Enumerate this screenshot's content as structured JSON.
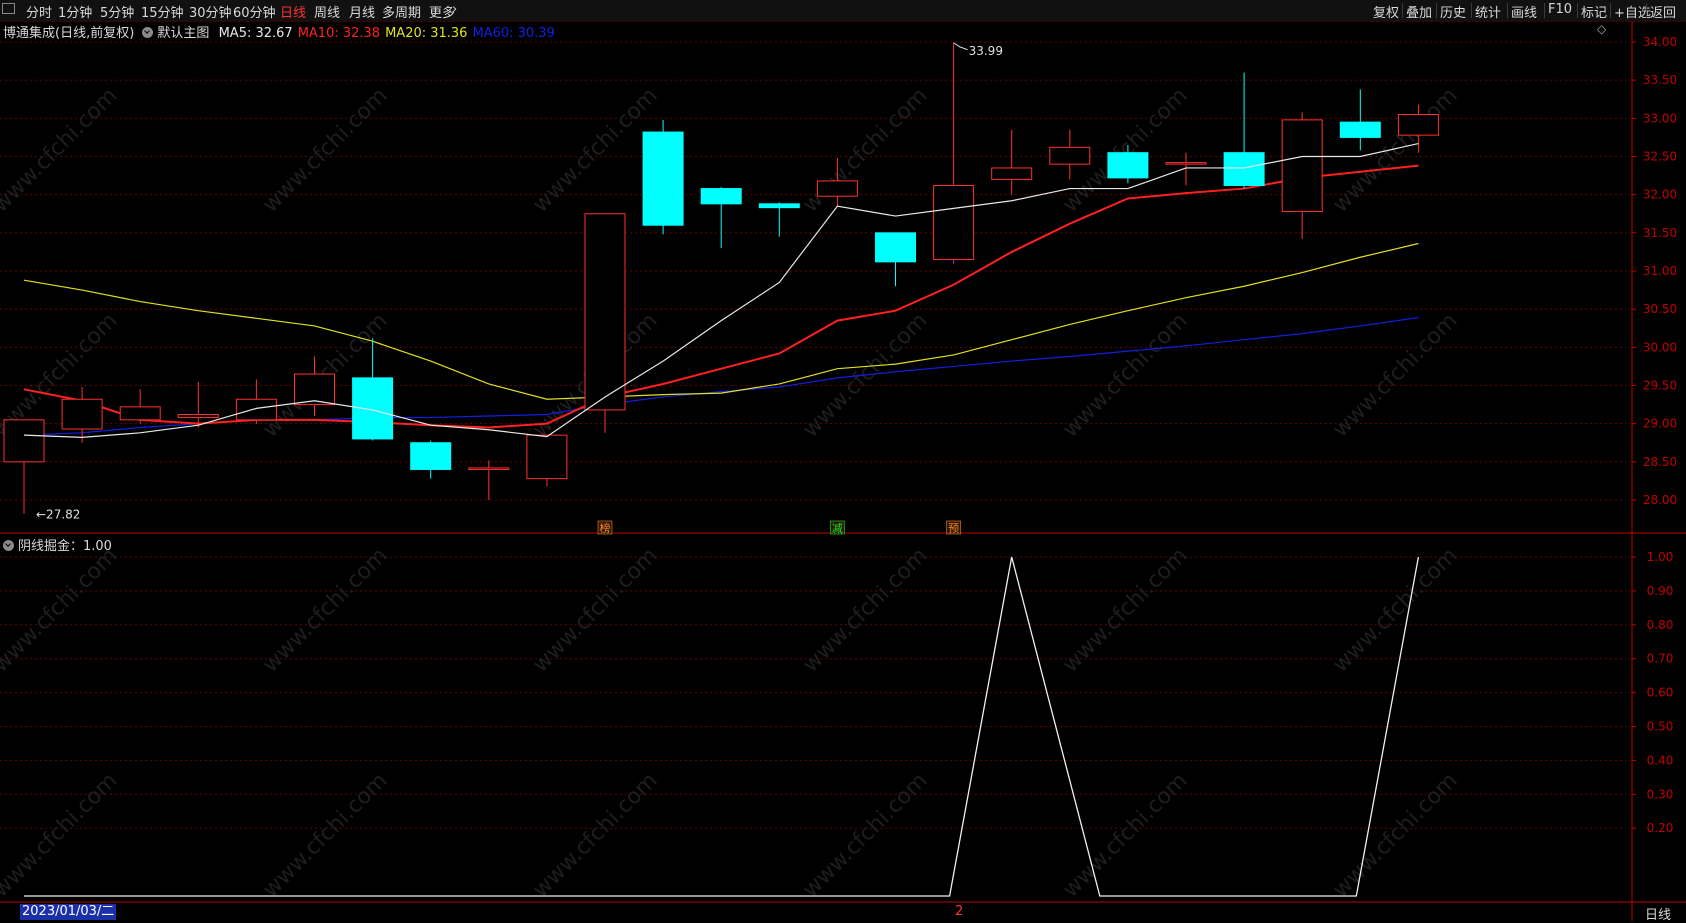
{
  "toolbar": {
    "corner_icon": "window-icon",
    "tabs": [
      "分时",
      "1分钟",
      "5分钟",
      "15分钟",
      "30分钟",
      "60分钟",
      "日线",
      "周线",
      "月线",
      "多周期",
      "更多"
    ],
    "active_tab": "日线",
    "more_chevron": "›",
    "right_buttons": [
      "复权",
      "叠加",
      "历史",
      "统计",
      "画线",
      "F10",
      "标记",
      "+自选",
      "返回"
    ]
  },
  "main_panel": {
    "stock_title": "博通集成(日线,前复权)",
    "template": "默认主图",
    "ma_labels": [
      {
        "text": "MA5: 32.67",
        "color": "#e8e8e8"
      },
      {
        "text": "MA10: 32.38",
        "color": "#ff2020"
      },
      {
        "text": "MA20: 31.36",
        "color": "#e0e020"
      },
      {
        "text": "MA60: 30.39",
        "color": "#1020e0"
      }
    ],
    "expand_icon": "diamond-icon",
    "high_label": "33.99",
    "low_label": "27.82",
    "markers": [
      {
        "text": "榜",
        "color": "#ff8020"
      },
      {
        "text": "减",
        "color": "#20e020"
      },
      {
        "text": "预",
        "color": "#ff8020"
      }
    ]
  },
  "indicator_panel": {
    "title": "阴线掘金：1.00"
  },
  "bottom_bar": {
    "date": "2023/01/03/二",
    "center_mark": "2",
    "period_label": "日线"
  },
  "watermark": "www.cfchi.com",
  "colors": {
    "up": "#ff3030",
    "down": "#00ffff",
    "ma5": "#e8e8e8",
    "ma10": "#ff2020",
    "ma20": "#e0e020",
    "ma60": "#1020e0",
    "axis": "#c00000"
  },
  "chart_data": {
    "type": "candlestick",
    "price_axis_ticks": [
      34.0,
      33.5,
      33.0,
      32.5,
      32.0,
      31.5,
      31.0,
      30.5,
      30.0,
      29.5,
      29.0,
      28.5,
      28.0
    ],
    "indicator_axis_ticks": [
      1.0,
      0.9,
      0.8,
      0.7,
      0.6,
      0.5,
      0.4,
      0.3,
      0.2
    ],
    "candles": [
      {
        "o": 28.5,
        "h": 29.05,
        "l": 27.82,
        "c": 29.05
      },
      {
        "o": 28.93,
        "h": 29.48,
        "l": 28.75,
        "c": 29.32
      },
      {
        "o": 29.05,
        "h": 29.45,
        "l": 29.0,
        "c": 29.22
      },
      {
        "o": 29.08,
        "h": 29.55,
        "l": 28.95,
        "c": 29.12
      },
      {
        "o": 29.05,
        "h": 29.58,
        "l": 29.0,
        "c": 29.32
      },
      {
        "o": 29.25,
        "h": 29.88,
        "l": 29.1,
        "c": 29.65
      },
      {
        "o": 29.6,
        "h": 30.12,
        "l": 28.78,
        "c": 28.8
      },
      {
        "o": 28.75,
        "h": 28.78,
        "l": 28.28,
        "c": 28.4
      },
      {
        "o": 28.42,
        "h": 28.52,
        "l": 28.0,
        "c": 28.42
      },
      {
        "o": 28.28,
        "h": 28.85,
        "l": 28.18,
        "c": 28.85
      },
      {
        "o": 29.18,
        "h": 31.75,
        "l": 28.88,
        "c": 31.75
      },
      {
        "o": 32.82,
        "h": 32.98,
        "l": 31.48,
        "c": 31.6
      },
      {
        "o": 32.08,
        "h": 32.1,
        "l": 31.3,
        "c": 31.88
      },
      {
        "o": 31.88,
        "h": 31.9,
        "l": 31.45,
        "c": 31.83
      },
      {
        "o": 31.98,
        "h": 32.48,
        "l": 31.85,
        "c": 32.18
      },
      {
        "o": 31.5,
        "h": 31.5,
        "l": 30.8,
        "c": 31.12
      },
      {
        "o": 31.15,
        "h": 33.99,
        "l": 31.1,
        "c": 32.12
      },
      {
        "o": 32.2,
        "h": 32.85,
        "l": 32.0,
        "c": 32.35
      },
      {
        "o": 32.4,
        "h": 32.85,
        "l": 32.2,
        "c": 32.62
      },
      {
        "o": 32.55,
        "h": 32.65,
        "l": 32.15,
        "c": 32.22
      },
      {
        "o": 32.42,
        "h": 32.55,
        "l": 32.12,
        "c": 32.42
      },
      {
        "o": 32.55,
        "h": 33.6,
        "l": 32.08,
        "c": 32.12
      },
      {
        "o": 31.78,
        "h": 33.08,
        "l": 31.42,
        "c": 32.98
      },
      {
        "o": 32.95,
        "h": 33.38,
        "l": 32.58,
        "c": 32.75
      },
      {
        "o": 32.78,
        "h": 33.18,
        "l": 32.55,
        "c": 33.05
      }
    ],
    "ma5": [
      28.85,
      28.82,
      28.88,
      28.98,
      29.2,
      29.3,
      29.18,
      28.98,
      28.92,
      28.83,
      29.35,
      29.82,
      30.35,
      30.85,
      31.85,
      31.72,
      31.82,
      31.92,
      32.08,
      32.08,
      32.35,
      32.35,
      32.5,
      32.5,
      32.67
    ],
    "ma10": [
      29.45,
      29.3,
      29.05,
      29.0,
      29.05,
      29.05,
      29.02,
      28.98,
      28.95,
      29.0,
      29.35,
      29.52,
      29.72,
      29.92,
      30.35,
      30.48,
      30.82,
      31.25,
      31.62,
      31.95,
      32.02,
      32.08,
      32.22,
      32.3,
      32.38
    ],
    "ma20": [
      30.88,
      30.75,
      30.6,
      30.48,
      30.38,
      30.28,
      30.08,
      29.82,
      29.52,
      29.32,
      29.35,
      29.38,
      29.4,
      29.52,
      29.72,
      29.78,
      29.9,
      30.1,
      30.3,
      30.48,
      30.65,
      30.8,
      30.98,
      31.18,
      31.36
    ],
    "ma60": [
      28.85,
      28.88,
      28.95,
      29.0,
      29.05,
      29.05,
      29.08,
      29.08,
      29.1,
      29.12,
      29.25,
      29.35,
      29.42,
      29.48,
      29.6,
      29.68,
      29.75,
      29.82,
      29.88,
      29.95,
      30.02,
      30.1,
      30.18,
      30.28,
      30.39
    ],
    "indicator": [
      0,
      0,
      0,
      0,
      0,
      0,
      0,
      0,
      0,
      0,
      0,
      0,
      0,
      0,
      0,
      0,
      0,
      1,
      0,
      0,
      0,
      0,
      0,
      0,
      1
    ]
  }
}
